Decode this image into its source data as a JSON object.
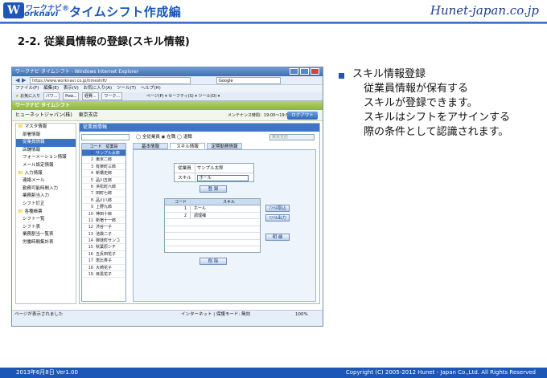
{
  "header": {
    "logo_letter": "W",
    "logo_top": "ワークナビ®",
    "logo_bottom": "orknavi",
    "title": "タイムシフト作成編",
    "brand": "Hunet-japan.co.jp"
  },
  "section": {
    "heading": "2-2. 従業員情報の登録(スキル情報)"
  },
  "bullet": {
    "lines": [
      "スキル情報登録",
      "従業員情報が保有する",
      "スキルが登録できます。",
      "スキルはシフトをアサインする",
      "際の条件として認識されます。"
    ]
  },
  "footer": {
    "date": "2013年6月8日 Ver1.00",
    "copyright": "Copyright (C) 2005-2012 Hunet - Japan Co.,Ltd. All Rights Reserved"
  },
  "browser": {
    "title": "ワークナビ タイムシフト - Windows Internet Explorer",
    "url": "https://www.worknavi.co.jp/timeshift/",
    "search_placeholder": "Google",
    "menu": [
      "ファイル(F)",
      "編集(E)",
      "表示(V)",
      "お気に入り(A)",
      "ツール(T)",
      "ヘルプ(H)"
    ],
    "favorites_label": "お気に入り",
    "fav_tabs": [
      "パワ...",
      "Pow...",
      "経費...",
      "ワーク..."
    ],
    "fav_tools": "ページ(P) ▾ セーフティ(S) ▾ ツール(O) ▾",
    "status_left": "ページが表示されました",
    "status_right": "インターネット | 保護モード: 無効",
    "zoom": "100%"
  },
  "app": {
    "name": "ワークナビ タイムシフト",
    "company": "ヒューネットジャパン(株)",
    "store": "東京支店",
    "maintenance": "メンテナンス時間：19:00〜19:59",
    "logout": "ログアウト",
    "sidebar": [
      {
        "label": "マスタ情報",
        "group": true
      },
      {
        "label": "部署情報"
      },
      {
        "label": "従業員情報",
        "selected": true
      },
      {
        "label": "店舗情報"
      },
      {
        "label": "フォーメーション情報"
      },
      {
        "label": "メール設定情報"
      },
      {
        "label": "入力情報",
        "group": true
      },
      {
        "label": "連絡メール"
      },
      {
        "label": "勤務可能時間入力"
      },
      {
        "label": "業務割当入力"
      },
      {
        "label": "シフト訂正"
      },
      {
        "label": "各種帳票",
        "group": true
      },
      {
        "label": "シフト一覧"
      },
      {
        "label": "シフト表"
      },
      {
        "label": "業務割当一覧表"
      },
      {
        "label": "労働時間集計表"
      }
    ],
    "section_title": "従業員情報",
    "radios": [
      "全従業員",
      "在職",
      "退職"
    ],
    "store_dropdown": "東京支店",
    "list_headers": [
      "コード",
      "従業員"
    ],
    "employees": [
      {
        "n": "1",
        "name": "サンプル太郎",
        "selected": true
      },
      {
        "n": "2",
        "name": "東京二郎"
      },
      {
        "n": "3",
        "name": "有楽町三郎"
      },
      {
        "n": "4",
        "name": "新橋史郎"
      },
      {
        "n": "5",
        "name": "品川五郎"
      },
      {
        "n": "6",
        "name": "浜松町六郎"
      },
      {
        "n": "7",
        "name": "田町七郎"
      },
      {
        "n": "8",
        "name": "品川八郎"
      },
      {
        "n": "9",
        "name": "上野九郎"
      },
      {
        "n": "10",
        "name": "神田十郎"
      },
      {
        "n": "11",
        "name": "新宿十一郎"
      },
      {
        "n": "12",
        "name": "渋谷一子"
      },
      {
        "n": "13",
        "name": "池袋二子"
      },
      {
        "n": "14",
        "name": "御徒町サンコ"
      },
      {
        "n": "15",
        "name": "秋葉原シチ"
      },
      {
        "n": "16",
        "name": "五反田花子"
      },
      {
        "n": "17",
        "name": "恵比寿子"
      },
      {
        "n": "18",
        "name": "大崎花子"
      },
      {
        "n": "19",
        "name": "目黒花子"
      }
    ],
    "tabs": [
      "基本情報",
      "スキル情報",
      "定期勤務情報"
    ],
    "active_tab": 1,
    "form": {
      "employee_label": "従業員",
      "employee_value": "サンプル太郎",
      "skill_label": "スキル",
      "skill_value": "ホール"
    },
    "register": "登 録",
    "skill_headers": [
      "コード",
      "スキル"
    ],
    "skills": [
      {
        "code": "1",
        "name": "ホール"
      },
      {
        "code": "2",
        "name": "調理補"
      }
    ],
    "import": "ﾌｧｲﾙ取込",
    "export": "ﾌｧｲﾙ出力",
    "memo": "明 細",
    "delete": "削 除"
  }
}
